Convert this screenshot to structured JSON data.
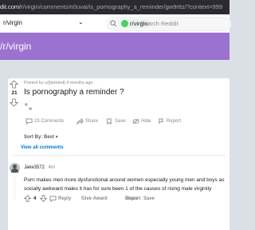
{
  "browser": {
    "url_prefix": "dit.com/",
    "url_path": "r/virgin/comments/n0uvai/is_pornography_a_reminder/gw9rttz/?context=999"
  },
  "header": {
    "subreddit_name": "r/virgin",
    "search_chip": "r/virgin",
    "search_placeholder": "Search Reddit"
  },
  "banner": {
    "title": "/r/virgin"
  },
  "post": {
    "posted_by": "Posted by u/[deleted] 4 months ago",
    "vote_count": "21",
    "title": "Is pornography a reminder ?",
    "actions": {
      "comments": "23 Comments",
      "share": "Share",
      "save": "Save",
      "hide": "Hide",
      "report": "Report"
    }
  },
  "sort": {
    "label": "Sort By: Best",
    "caret": "▾"
  },
  "view_all_comments": "View all comments",
  "comment": {
    "author": "Jake3572",
    "meta": "· 4m",
    "body_lines": [
      "Porn makes men more dysfunctional around women especially young men and boys as",
      "socially awkward males it has for sure been 1 of the causes of rising male virginity"
    ],
    "vote_count": "4",
    "actions": {
      "reply": "Reply",
      "give_award": "Give Award",
      "share": "Share",
      "report": "Report",
      "save": "Save"
    }
  },
  "colors": {
    "banner": "#9b72cf",
    "link": "#0079d3",
    "muted": "#878a8c",
    "background": "#dae0e6"
  }
}
